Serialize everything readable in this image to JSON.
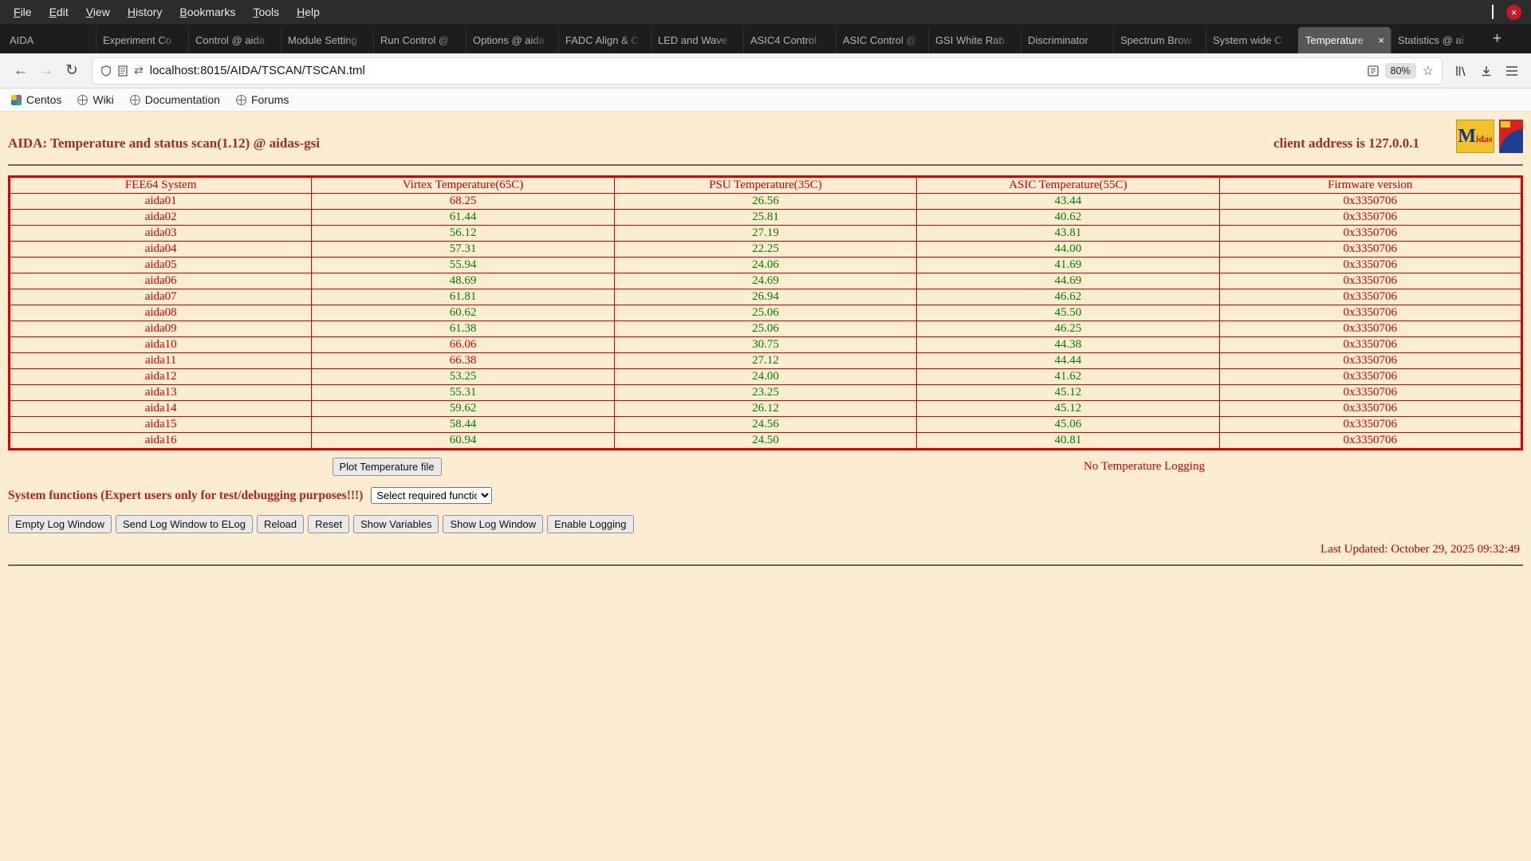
{
  "window": {
    "menu": [
      "File",
      "Edit",
      "View",
      "History",
      "Bookmarks",
      "Tools",
      "Help"
    ]
  },
  "icons": {
    "plus": "+",
    "back": "←",
    "forward": "→",
    "reload": "↻",
    "swap": "⇄",
    "star": "☆",
    "close_x": "×"
  },
  "tabs": {
    "items": [
      {
        "label": "AIDA"
      },
      {
        "label": "Experiment Co"
      },
      {
        "label": "Control @ aida"
      },
      {
        "label": "Module Setting"
      },
      {
        "label": "Run Control @"
      },
      {
        "label": "Options @ aida"
      },
      {
        "label": "FADC Align & C"
      },
      {
        "label": "LED and Wave"
      },
      {
        "label": "ASIC4 Control"
      },
      {
        "label": "ASIC Control @"
      },
      {
        "label": "GSI White Rab"
      },
      {
        "label": "Discriminator"
      },
      {
        "label": "Spectrum Brow"
      },
      {
        "label": "System wide C"
      },
      {
        "label": "Temperature",
        "state": "active"
      },
      {
        "label": "Statistics @ ai"
      }
    ]
  },
  "nav": {
    "url": "localhost:8015/AIDA/TSCAN/TSCAN.tml",
    "zoom": "80%"
  },
  "bookmarks": {
    "items": [
      {
        "label": "Centos",
        "icon": "centos"
      },
      {
        "label": "Wiki",
        "icon": "globe"
      },
      {
        "label": "Documentation",
        "icon": "globe"
      },
      {
        "label": "Forums",
        "icon": "globe"
      }
    ]
  },
  "page": {
    "title": "AIDA: Temperature and status scan(1.12) @ aidas-gsi",
    "client_address": "client address is 127.0.0.1",
    "logo_text": "Midas",
    "table": {
      "headers": [
        "FEE64 System",
        "Virtex Temperature(65C)",
        "PSU Temperature(35C)",
        "ASIC Temperature(55C)",
        "Firmware version"
      ],
      "rows": [
        {
          "name": "aida01",
          "virtex": "68.25",
          "vclass": "hot",
          "psu": "26.56",
          "asic": "43.44",
          "fw": "0x3350706"
        },
        {
          "name": "aida02",
          "virtex": "61.44",
          "vclass": "ok",
          "psu": "25.81",
          "asic": "40.62",
          "fw": "0x3350706"
        },
        {
          "name": "aida03",
          "virtex": "56.12",
          "vclass": "ok",
          "psu": "27.19",
          "asic": "43.81",
          "fw": "0x3350706"
        },
        {
          "name": "aida04",
          "virtex": "57.31",
          "vclass": "ok",
          "psu": "22.25",
          "asic": "44.00",
          "fw": "0x3350706"
        },
        {
          "name": "aida05",
          "virtex": "55.94",
          "vclass": "ok",
          "psu": "24.06",
          "asic": "41.69",
          "fw": "0x3350706"
        },
        {
          "name": "aida06",
          "virtex": "48.69",
          "vclass": "ok",
          "psu": "24.69",
          "asic": "44.69",
          "fw": "0x3350706"
        },
        {
          "name": "aida07",
          "virtex": "61.81",
          "vclass": "ok",
          "psu": "26.94",
          "asic": "46.62",
          "fw": "0x3350706"
        },
        {
          "name": "aida08",
          "virtex": "60.62",
          "vclass": "ok",
          "psu": "25.06",
          "asic": "45.50",
          "fw": "0x3350706"
        },
        {
          "name": "aida09",
          "virtex": "61.38",
          "vclass": "ok",
          "psu": "25.06",
          "asic": "46.25",
          "fw": "0x3350706"
        },
        {
          "name": "aida10",
          "virtex": "66.06",
          "vclass": "hot",
          "psu": "30.75",
          "asic": "44.38",
          "fw": "0x3350706"
        },
        {
          "name": "aida11",
          "virtex": "66.38",
          "vclass": "hot",
          "psu": "27.12",
          "asic": "44.44",
          "fw": "0x3350706"
        },
        {
          "name": "aida12",
          "virtex": "53.25",
          "vclass": "ok",
          "psu": "24.00",
          "asic": "41.62",
          "fw": "0x3350706"
        },
        {
          "name": "aida13",
          "virtex": "55.31",
          "vclass": "ok",
          "psu": "23.25",
          "asic": "45.12",
          "fw": "0x3350706"
        },
        {
          "name": "aida14",
          "virtex": "59.62",
          "vclass": "ok",
          "psu": "26.12",
          "asic": "45.12",
          "fw": "0x3350706"
        },
        {
          "name": "aida15",
          "virtex": "58.44",
          "vclass": "ok",
          "psu": "24.56",
          "asic": "45.06",
          "fw": "0x3350706"
        },
        {
          "name": "aida16",
          "virtex": "60.94",
          "vclass": "ok",
          "psu": "24.50",
          "asic": "40.81",
          "fw": "0x3350706"
        }
      ]
    },
    "plot_button": "Plot Temperature file",
    "logging_status": "No Temperature Logging",
    "system_functions_label": "System functions (Expert users only for test/debugging purposes!!!)",
    "select_placeholder": "Select required function",
    "action_buttons": [
      "Empty Log Window",
      "Send Log Window to ELog",
      "Reload",
      "Reset",
      "Show Variables",
      "Show Log Window",
      "Enable Logging"
    ],
    "last_updated": "Last Updated: October 29, 2025 09:32:49"
  }
}
